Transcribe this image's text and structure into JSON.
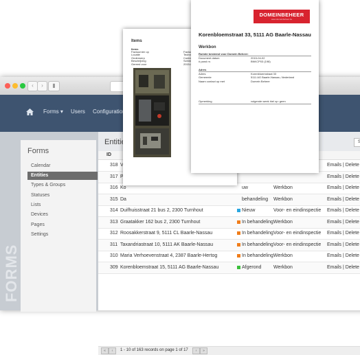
{
  "nav": {
    "home_icon": "home-icon",
    "forms": "Forms",
    "users": "Users",
    "configuration": "Configuration"
  },
  "sidebar": {
    "brand": "FORMS",
    "title": "Forms",
    "items": [
      {
        "label": "Calendar",
        "active": false
      },
      {
        "label": "Entities",
        "active": true
      },
      {
        "label": "Types & Groups",
        "active": false
      },
      {
        "label": "Statuses",
        "active": false
      },
      {
        "label": "Lists",
        "active": false
      },
      {
        "label": "Devices",
        "active": false
      },
      {
        "label": "Pages",
        "active": false
      },
      {
        "label": "Settings",
        "active": false
      }
    ]
  },
  "entities": {
    "title": "Entities",
    "search_button": "S",
    "col_id": "ID",
    "rows": [
      {
        "id": "318",
        "address": "Ve",
        "status": "",
        "status_color": "",
        "type": "",
        "actions": "Emails | Delete | E"
      },
      {
        "id": "317",
        "address": "Pa",
        "status": "",
        "status_color": "",
        "type": "",
        "actions": "Emails | Delete | E"
      },
      {
        "id": "316",
        "address": "Ko",
        "status": "uw",
        "status_color": "",
        "type": "Werkbon",
        "actions": "Emails | Delete | E"
      },
      {
        "id": "315",
        "address": "Da",
        "status": "behandeling",
        "status_color": "",
        "type": "Werkbon",
        "actions": "Emails | Delete | E"
      },
      {
        "id": "314",
        "address": "Duifhuisstraat 21 bus 2, 2300 Turnhout",
        "status": "Nieuw",
        "status_color": "#2aa7e0",
        "type": "Voor- en eindinspectie",
        "actions": "Emails | Delete | E"
      },
      {
        "id": "313",
        "address": "Graatakker 162 bus 2, 2300 Turnhout",
        "status": "In behandeling",
        "status_color": "#f07d1a",
        "type": "Werkbon",
        "actions": "Emails | Delete | E"
      },
      {
        "id": "312",
        "address": "Roosakkerstraat 9, 5111 CL Baarle-Nassau",
        "status": "In behandeling",
        "status_color": "#f07d1a",
        "type": "Voor- en eindinspectie",
        "actions": "Emails | Delete | E"
      },
      {
        "id": "311",
        "address": "Taxandriastraat 10, 5111 AK Baarle-Nassau",
        "status": "In behandeling",
        "status_color": "#f07d1a",
        "type": "Voor- en eindinspectie",
        "actions": "Emails | Delete | E"
      },
      {
        "id": "310",
        "address": "Maria Verhoevenstraat 4, 2387 Baarle-Hertog",
        "status": "In behandeling",
        "status_color": "#f07d1a",
        "type": "Werkbon",
        "actions": "Emails | Delete | E"
      },
      {
        "id": "309",
        "address": "Korenbloemstraat 15, 5111 AG Baarle-Nassau",
        "status": "Afgerond",
        "status_color": "#3cc03c",
        "type": "Werkbon",
        "actions": "Emails | Delete | E"
      }
    ],
    "pager_text": "1 - 10 of 163 records on page 1 of 17"
  },
  "doc_items": {
    "title": "Items",
    "section": "Items",
    "labels": [
      "Factuurnier op",
      "Locatie",
      "Onderwerp",
      "Beschrijving",
      "Gereed voor"
    ],
    "values": [
      "Factuu",
      "Techni",
      "Contro",
      "Schimi",
      "2015-0"
    ]
  },
  "doc_werkbon": {
    "logo": "DOMEINBEHEER",
    "logo_sub": "www.domeinbeheer.be",
    "heading": "Korenbloemstraat 33, 5111 AG Baarle-Nassau",
    "subheading": "Werkbon",
    "section1_title": "Ruimte bestemd voor Domein Beheer:",
    "section1_labels": [
      "Document datum",
      "# pand nr."
    ],
    "section1_values": [
      "2015-04-02",
      "BNKCP03 (198)"
    ],
    "section2_title": "Adres",
    "section2_labels": [
      "Adres",
      "Gemeente",
      "Naam contact op met"
    ],
    "section2_values": [
      "Korenbloemstraat 33",
      "5111 AG Baarle-Nassau, Nederland",
      "Domein Beheer"
    ],
    "section3_label": "Opmerking",
    "section3_value": "volgende week hiel op: geen"
  }
}
